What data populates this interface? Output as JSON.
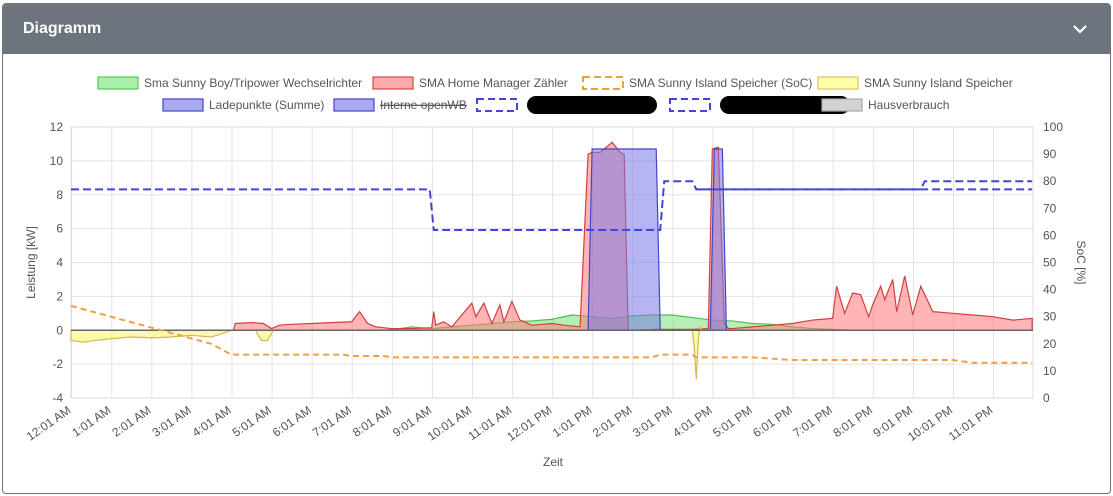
{
  "card": {
    "title": "Diagramm",
    "collapse_icon": "chevron-down-icon"
  },
  "chart_data": {
    "type": "area",
    "xlabel": "Zeit",
    "ylabel_left": "Leistung [kW]",
    "ylabel_right": "SoC [%]",
    "ylim_left": [
      -4,
      12
    ],
    "ylim_right": [
      0,
      100
    ],
    "y_ticks_left": [
      "-4",
      "-2",
      "0",
      "2",
      "4",
      "6",
      "8",
      "10",
      "12"
    ],
    "y_ticks_right": [
      "0",
      "10",
      "20",
      "30",
      "40",
      "50",
      "60",
      "70",
      "80",
      "90",
      "100"
    ],
    "x_ticks": [
      "12:01 AM",
      "1:01 AM",
      "2:01 AM",
      "3:01 AM",
      "4:01 AM",
      "5:01 AM",
      "6:01 AM",
      "7:01 AM",
      "8:01 AM",
      "9:01 AM",
      "10:01 AM",
      "11:01 AM",
      "12:01 PM",
      "1:01 PM",
      "2:01 PM",
      "3:01 PM",
      "4:01 PM",
      "5:01 PM",
      "6:01 PM",
      "7:01 PM",
      "8:01 PM",
      "9:01 PM",
      "10:01 PM",
      "11:01 PM"
    ],
    "grid": true,
    "legend_position": "top",
    "legend": [
      {
        "label": "Sma Sunny Boy/Tripower Wechselrichter",
        "fill": "#aaf0aa",
        "stroke": "#55cc55",
        "style": "solid",
        "hidden": false
      },
      {
        "label": "SMA Home Manager Zähler",
        "fill": "#ffaaaa",
        "stroke": "#dd4444",
        "style": "solid",
        "hidden": false
      },
      {
        "label": "SMA Sunny Island Speicher (SoC)",
        "fill": "#ffffff",
        "stroke": "#f0a030",
        "style": "dashed",
        "hidden": false
      },
      {
        "label": "SMA Sunny Island Speicher",
        "fill": "#ffffaa",
        "stroke": "#e0c060",
        "style": "solid",
        "hidden": false
      },
      {
        "label": "Ladepunkte (Summe)",
        "fill": "#aaaaee",
        "stroke": "#4444cc",
        "style": "solid",
        "hidden": false
      },
      {
        "label": "Interne openWB",
        "fill": "#aaaaee",
        "stroke": "#4444cc",
        "style": "solid",
        "hidden": true
      },
      {
        "label": "",
        "fill": "#ffffff",
        "stroke": "#4444dd",
        "style": "dashed",
        "hidden": false,
        "redacted": true
      },
      {
        "label": "",
        "fill": "#ffffff",
        "stroke": "#4444dd",
        "style": "dashed",
        "hidden": false,
        "redacted": true
      },
      {
        "label": "Hausverbrauch",
        "fill": "#d3d3d3",
        "stroke": "#aaaaaa",
        "style": "solid",
        "hidden": false
      }
    ],
    "series": [
      {
        "name": "Sma Sunny Boy/Tripower Wechselrichter",
        "axis": "left",
        "fill": "rgba(120,225,120,0.55)",
        "stroke": "#55bb55",
        "x": [
          0,
          7.8,
          8.2,
          8.5,
          9,
          9.5,
          10,
          10.5,
          11,
          11.5,
          12,
          12.5,
          13,
          13.5,
          14,
          14.5,
          15,
          15.5,
          16,
          16.5,
          17,
          17.5,
          18,
          18.5,
          19,
          19.5,
          23.98
        ],
        "y": [
          0,
          0,
          0.1,
          0.2,
          0.1,
          0.2,
          0.3,
          0.4,
          0.5,
          0.55,
          0.65,
          0.9,
          0.8,
          0.7,
          0.85,
          0.9,
          0.9,
          0.75,
          0.6,
          0.55,
          0.4,
          0.35,
          0.2,
          0.1,
          0.05,
          0,
          0
        ]
      },
      {
        "name": "SMA Home Manager Zähler",
        "axis": "left",
        "fill": "rgba(255,120,120,0.55)",
        "stroke": "#d04040",
        "x": [
          0,
          4.05,
          4.1,
          4.5,
          4.8,
          5.0,
          5.2,
          5.5,
          6,
          6.5,
          7,
          7.2,
          7.4,
          7.6,
          8,
          8.5,
          9,
          9.05,
          9.1,
          9.3,
          9.5,
          10,
          10.1,
          10.3,
          10.5,
          10.7,
          10.8,
          11,
          11.2,
          11.5,
          12,
          12.3,
          12.7,
          12.9,
          13.0,
          13.2,
          13.5,
          13.7,
          13.8,
          13.9,
          14.6,
          15,
          15.5,
          15.9,
          16.0,
          16.15,
          16.3,
          16.4,
          16.5,
          17,
          17.5,
          18,
          18.5,
          19,
          19.1,
          19.3,
          19.5,
          19.7,
          19.9,
          20,
          20.2,
          20.3,
          20.5,
          20.6,
          20.8,
          21,
          21.2,
          21.5,
          22,
          22.5,
          23,
          23.5,
          23.98
        ],
        "y": [
          0,
          0,
          0.4,
          0.45,
          0.4,
          0.1,
          0.3,
          0.35,
          0.4,
          0.45,
          0.5,
          1.1,
          0.4,
          0.2,
          0.1,
          0.1,
          0.15,
          1.1,
          0.3,
          0.5,
          0.2,
          1.6,
          0.8,
          1.6,
          0.4,
          1.5,
          0.5,
          1.7,
          0.6,
          0.3,
          0.4,
          0.3,
          0.2,
          10.4,
          10.5,
          10.5,
          11.1,
          10.5,
          10.4,
          0,
          0.05,
          0.05,
          0.05,
          0.1,
          10.7,
          10.8,
          0.4,
          0.1,
          0.1,
          0.2,
          0.3,
          0.4,
          0.6,
          0.7,
          2.6,
          1.0,
          2.2,
          2.1,
          0.8,
          1.5,
          2.6,
          1.8,
          3.0,
          1.1,
          3.2,
          0.9,
          2.6,
          1.1,
          1.0,
          0.9,
          0.8,
          0.6,
          0.7
        ]
      },
      {
        "name": "SMA Sunny Island Speicher",
        "axis": "left",
        "fill": "rgba(250,250,130,0.7)",
        "stroke": "#d4b850",
        "x": [
          0,
          0.3,
          0.6,
          1,
          1.5,
          2,
          2.5,
          3,
          3.5,
          3.9,
          4.0,
          4.6,
          4.7,
          4.75,
          4.9,
          5.0,
          5.05,
          15.5,
          15.55,
          15.6,
          15.65,
          15.7,
          15.75,
          15.8,
          23.98
        ],
        "y": [
          -0.6,
          -0.7,
          -0.6,
          -0.5,
          -0.4,
          -0.45,
          -0.4,
          -0.3,
          -0.4,
          -0.1,
          0,
          0,
          -0.4,
          -0.6,
          -0.6,
          -0.2,
          0,
          0,
          -1.0,
          -2.9,
          -0.5,
          0.2,
          0,
          0,
          0
        ]
      },
      {
        "name": "Ladepunkte (Summe)",
        "axis": "left",
        "fill": "rgba(120,120,230,0.55)",
        "stroke": "#4444cc",
        "x": [
          0,
          12.9,
          13.0,
          14.6,
          14.7,
          15.95,
          16.05,
          16.25,
          16.35,
          23.98
        ],
        "y": [
          0,
          0,
          10.7,
          10.7,
          0,
          0,
          10.7,
          10.7,
          0,
          0
        ]
      },
      {
        "name": "Hausverbrauch",
        "axis": "left",
        "fill": "rgba(170,170,170,0.3)",
        "stroke": "#777777",
        "x": [
          0,
          23.98
        ],
        "y": [
          0,
          0
        ]
      },
      {
        "name": "SMA Sunny Island Speicher (SoC)",
        "axis": "right",
        "type": "line",
        "dash": "6,4",
        "stroke": "#f0a040",
        "x": [
          0,
          0.5,
          1,
          1.5,
          2,
          2.5,
          3,
          3.5,
          4,
          5,
          6,
          6.8,
          7,
          7.8,
          8,
          9,
          10,
          11,
          12,
          13,
          14,
          14.5,
          14.7,
          15.5,
          15.6,
          16,
          17,
          18,
          19,
          20,
          21,
          22,
          22.5,
          23.98
        ],
        "y": [
          34,
          32,
          30,
          28,
          26,
          24,
          22,
          20,
          16,
          16,
          16,
          16,
          15.5,
          15.5,
          15,
          15,
          15,
          15,
          15,
          15,
          15,
          15,
          16,
          16,
          15,
          15,
          15,
          14,
          14,
          14,
          14,
          14,
          13,
          13
        ]
      },
      {
        "name": "",
        "axis": "right",
        "type": "line",
        "dash": "8,4",
        "stroke": "#4444dd",
        "x": [
          0,
          8.95,
          9.05,
          14.7,
          14.8,
          15.5,
          15.6,
          23.98
        ],
        "y": [
          77,
          77,
          62,
          62,
          80,
          80,
          77,
          77
        ]
      },
      {
        "name": "",
        "axis": "right",
        "type": "line",
        "dash": "8,4",
        "stroke": "#4444dd",
        "x": [
          15.6,
          21.2,
          21.3,
          23.98
        ],
        "y": [
          77,
          77,
          80,
          80
        ]
      }
    ]
  }
}
